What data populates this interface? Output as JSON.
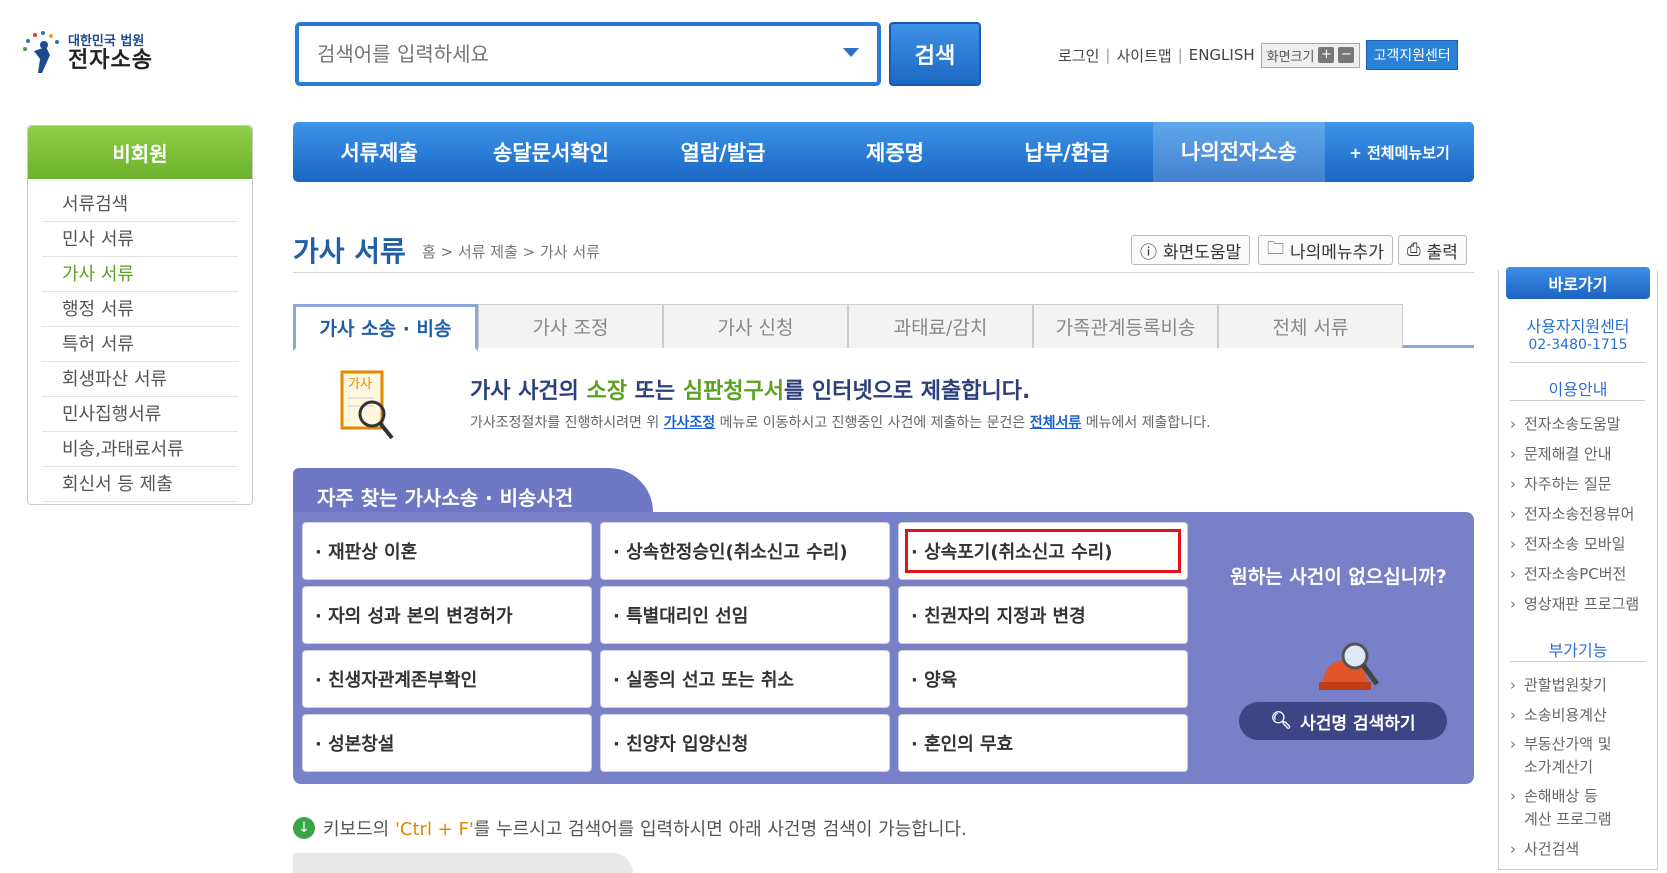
{
  "logo": {
    "small": "대한민국 법원",
    "big": "전자소송"
  },
  "search": {
    "placeholder": "검색어를 입력하세요",
    "button": "검색"
  },
  "util": {
    "login": "로그인",
    "sitemap": "사이트맵",
    "english": "ENGLISH",
    "font_size": "화면크기",
    "font_plus": "+",
    "font_minus": "−",
    "customer_center": "고객지원센터"
  },
  "sidebar": {
    "title": "비회원",
    "items": [
      "서류검색",
      "민사 서류",
      "가사 서류",
      "행정 서류",
      "특허 서류",
      "회생파산 서류",
      "민사집행서류",
      "비송,과태료서류",
      "회신서 등 제출"
    ]
  },
  "nav": {
    "items": [
      "서류제출",
      "송달문서확인",
      "열람/발급",
      "제증명",
      "납부/환급",
      "나의전자소송"
    ],
    "all": "+ 전체메뉴보기"
  },
  "page": {
    "title": "가사 서류",
    "breadcrumb": "홈 > 서류 제출 > 가사 서류",
    "help": "화면도움말",
    "add_menu": "나의메뉴추가",
    "print": "출력"
  },
  "tabs": [
    "가사 소송 · 비송",
    "가사 조정",
    "가사 신청",
    "과태료/감치",
    "가족관계등록비송",
    "전체 서류"
  ],
  "info": {
    "icon_label": "가사",
    "h_pre": "가사 사건의 ",
    "h_g1": "소장",
    "h_mid": " 또는 ",
    "h_g2": "심판청구서",
    "h_post": "를 인터넷으로 제출합니다.",
    "p_pre": "가사조정절차를 진행하시려면 위 ",
    "p_link1": "가사조정",
    "p_mid": " 메뉴로 이동하시고 진행중인 사건에 제출하는 문건은 ",
    "p_link2": "전체서류",
    "p_post": " 메뉴에서 제출합니다."
  },
  "frequent": {
    "title": "자주 찾는 가사소송 · 비송사건",
    "cells": [
      "· 재판상 이혼",
      "· 상속한정승인(취소신고 수리)",
      "· 상속포기(취소신고 수리)",
      "· 자의 성과 본의 변경허가",
      "· 특별대리인 선임",
      "· 친권자의 지정과 변경",
      "· 친생자관계존부확인",
      "· 실종의 선고 또는 취소",
      "· 양육",
      "· 성본창설",
      "· 친양자 입양신청",
      "· 혼인의 무효"
    ],
    "question": "원하는 사건이 없으십니까?",
    "find": "사건명 검색하기"
  },
  "keyboard": {
    "pre": "키보드의 ",
    "key": "'Ctrl + F'",
    "post": "를 누르시고 검색어를 입력하시면 아래 사건명 검색이 가능합니다."
  },
  "quick": {
    "title": "바로가기",
    "center": "사용자지원센터",
    "phone": "02-3480-1715",
    "guide": "이용안내",
    "guide_items": [
      "전자소송도움말",
      "문제해결 안내",
      "자주하는 질문",
      "전자소송전용뷰어",
      "전자소송 모바일",
      "전자소송PC버전",
      "영상재판 프로그램"
    ],
    "extra": "부가기능",
    "extra_items": [
      "관할법원찾기",
      "소송비용계산",
      "부동산가액 및\n소가계산기",
      "손해배상 등\n계산 프로그램",
      "사건검색"
    ]
  },
  "colors": {
    "primary": "#1e6ac8",
    "green": "#6cb22c",
    "purple": "#7880c8",
    "highlight": "#e0141e"
  }
}
